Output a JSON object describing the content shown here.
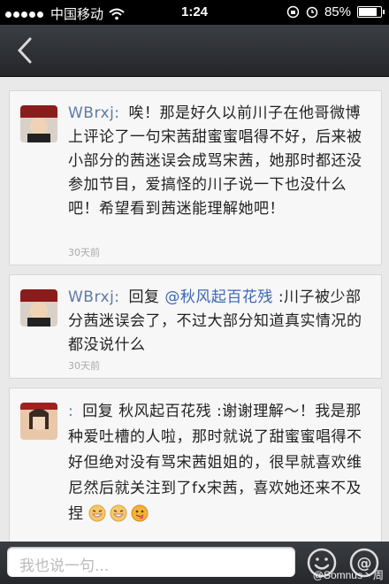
{
  "status_bar": {
    "carrier": "中国移动",
    "time": "1:24",
    "battery_percent": "85%",
    "battery_level": 0.85
  },
  "comments": [
    {
      "username": "WBrxj:",
      "text": "唉！那是好久以前川子在他哥微博上评论了一句宋茜甜蜜蜜唱得不好，后来被小部分的茜迷误会成骂宋茜，她那时都还没参加节目，爱搞怪的川子说一下也没什么吧！希望看到茜迷能理解她吧！",
      "time": "30天前"
    },
    {
      "username": "WBrxj:",
      "reply_prefix": "回复",
      "mention": "@秋风起百花残",
      "text": ":川子被少部分茜迷误会了，不过大部分知道真实情况的都没说什么",
      "time": "30天前"
    },
    {
      "username": ":",
      "text": "回复 秋风起百花残 :谢谢理解～！我是那种爱吐槽的人啦，那时就说了甜蜜蜜唱得不好但绝对没有骂宋茜姐姐的，很早就喜欢维尼然后就关注到了fx宋茜，喜欢她还来不及捏"
    }
  ],
  "input_bar": {
    "placeholder": "我也说一句...",
    "emoji_icon": "smiley-icon",
    "mention_icon": "at-icon"
  },
  "watermark": "@Somnus丶周"
}
